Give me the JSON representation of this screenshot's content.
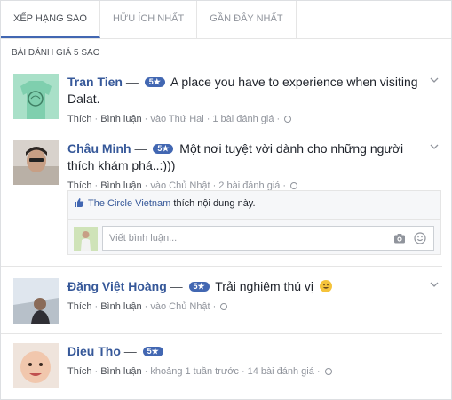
{
  "tabs": [
    {
      "label": "Xếp hạng sao",
      "active": true
    },
    {
      "label": "Hữu ích nhất",
      "active": false
    },
    {
      "label": "Gần đây nhất",
      "active": false
    }
  ],
  "section_label": "Bài đánh giá 5 sao",
  "colors": {
    "accent": "#4267b2",
    "link": "#365899",
    "meta": "#90949c",
    "divider": "#e5e5e5"
  },
  "reviews": [
    {
      "name": "Tran Tien",
      "dash": "—",
      "rating": "5★",
      "text": "A place you have to experience when visiting Dalat.",
      "like_label": "Thích",
      "comment_label": "Bình luận",
      "time": "vào Thứ Hai",
      "review_count": "1 bài đánh giá",
      "avatar_icon": "green-tshirt-avatar"
    },
    {
      "name": "Châu Minh",
      "dash": "—",
      "rating": "5★",
      "text": "Một nơi tuyệt vời dành cho những người thích khám phá..:)))",
      "like_label": "Thích",
      "comment_label": "Bình luận",
      "time": "vào Chủ Nhật",
      "review_count": "2 bài đánh giá",
      "avatar_icon": "person-photo-avatar",
      "liked_by": {
        "page": "The Circle Vietnam",
        "suffix": "thích nội dung này."
      },
      "comment_placeholder": "Viết bình luận..."
    },
    {
      "name": "Đặng Việt Hoàng",
      "dash": "—",
      "rating": "5★",
      "text": "Trải nghiệm thú vị",
      "like_label": "Thích",
      "comment_label": "Bình luận",
      "time": "vào Chủ Nhật",
      "avatar_icon": "person-outdoor-avatar"
    },
    {
      "name": "Dieu Tho",
      "dash": "—",
      "rating": "5★",
      "text": "",
      "like_label": "Thích",
      "comment_label": "Bình luận",
      "time": "khoảng 1 tuần trước",
      "review_count": "14 bài đánh giá",
      "avatar_icon": "baby-photo-avatar"
    }
  ]
}
